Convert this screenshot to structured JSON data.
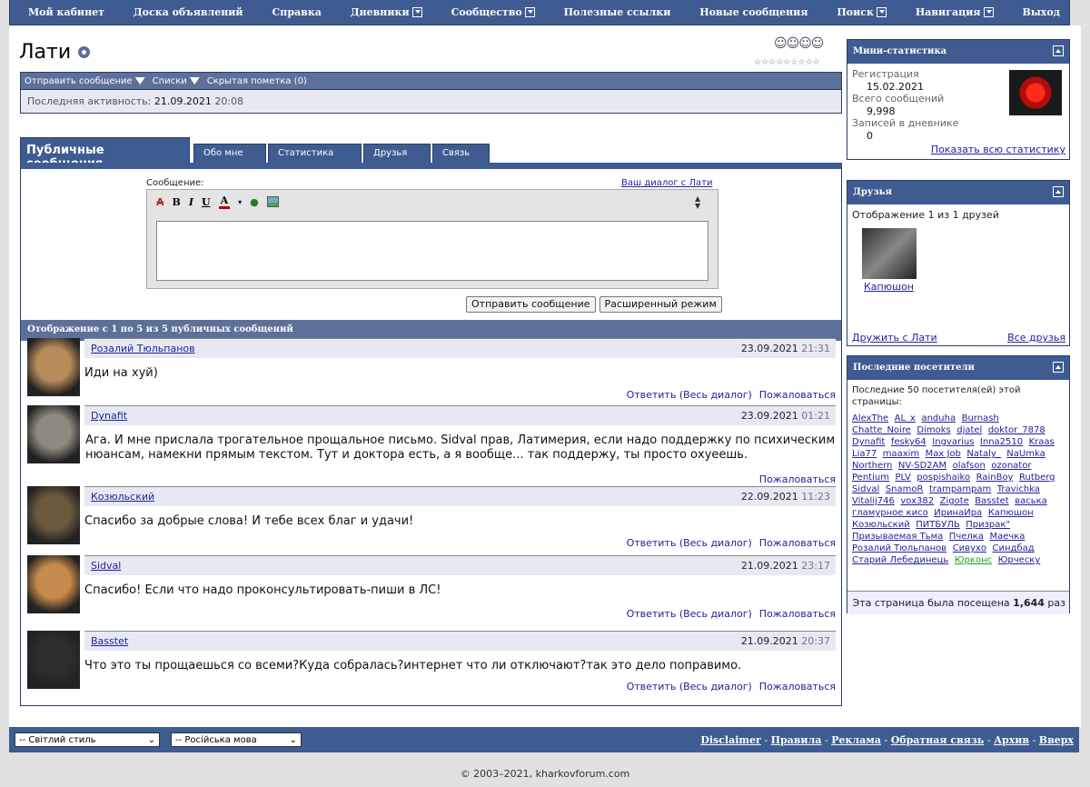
{
  "nav": [
    "Мой кабинет",
    "Доска объявлений",
    "Справка",
    "Дневники",
    "Сообщество",
    "Полезные ссылки",
    "Новые сообщения",
    "Поиск",
    "Навигация",
    "Выход"
  ],
  "nav_dropdown": [
    false,
    false,
    false,
    true,
    true,
    false,
    false,
    true,
    true,
    false
  ],
  "profile": {
    "name": "Лати",
    "smileys": "☺☺☺☺",
    "stars": "☆☆☆☆☆☆☆☆☆",
    "actions": [
      "Отправить сообщение",
      "Списки",
      "Скрытая пометка (0)"
    ],
    "activity_label": "Последняя активность:",
    "activity_date": "21.09.2021",
    "activity_time": "20:08"
  },
  "tabs": [
    "Публичные сообщения",
    "Обо мне",
    "Статистика",
    "Друзья",
    "Связь"
  ],
  "editor": {
    "label": "Сообщение:",
    "dialog_link": "Ваш диалог с Лати",
    "tools": [
      "B",
      "I",
      "U",
      "A"
    ],
    "send": "Отправить сообщение",
    "advanced": "Расширенный режим"
  },
  "list_header": "Отображение с 1 по 5 из 5 публичных сообщений",
  "messages": [
    {
      "user": "Розалий Тюльпанов",
      "date": "23.09.2021",
      "time": "21:31",
      "text": "Иди на хуй)",
      "reply": "Ответить (Весь диалог)",
      "report": "Пожаловаться",
      "color": "#b88c5a"
    },
    {
      "user": "Dynafit",
      "date": "23.09.2021",
      "time": "01:21",
      "text": "Ага. И мне прислала трогательное прощальное письмо. Sidval прав, Латимерия, если надо поддержку по психическим нюансам, намекни прямым текстом. Тут и доктора есть, а я вообще... так поддержу, ты просто охуеешь.",
      "reply": "",
      "report": "Пожаловаться",
      "color": "#8f8a80"
    },
    {
      "user": "Козюльский",
      "date": "22.09.2021",
      "time": "11:23",
      "text": "Спасибо за добрые слова! И тебе всех благ и удачи!",
      "reply": "Ответить (Весь диалог)",
      "report": "Пожаловаться",
      "color": "#6b5a3e"
    },
    {
      "user": "Sidval",
      "date": "21.09.2021",
      "time": "23:17",
      "text": "Спасибо! Если что надо проконсультировать-пиши в ЛС!",
      "reply": "Ответить (Весь диалог)",
      "report": "Пожаловаться",
      "color": "#c78a4c"
    },
    {
      "user": "Basstet",
      "date": "21.09.2021",
      "time": "20:37",
      "text": "Что это ты прощаешься со всеми?Куда собралась?интернет что ли отключают?так это дело поправимо.",
      "reply": "Ответить (Весь диалог)",
      "report": "Пожаловаться",
      "color": "#2d2d2d"
    }
  ],
  "ministats": {
    "title": "Мини-статистика",
    "reg_label": "Регистрация",
    "reg_value": "15.02.2021",
    "posts_label": "Всего сообщений",
    "posts_value": "9,998",
    "diary_label": "Записей в дневнике",
    "diary_value": "0",
    "show_all": "Показать всю статистику"
  },
  "friends": {
    "title": "Друзья",
    "showing": "Отображение 1 из 1 друзей",
    "friend": "Капюшон",
    "befriend": "Дружить с Лати",
    "all": "Все друзья"
  },
  "visitors": {
    "title": "Последние посетители",
    "intro": "Последние 50 посетителя(ей) этой страницы:",
    "names": [
      "AlexThe",
      "AL_x",
      "anduha",
      "Burnash",
      "Chatte_Noire",
      "Dimoks",
      "djatel",
      "doktor_7878",
      "Dynafit",
      "fesky64",
      "Ingvarius",
      "Inna2510",
      "Kraas",
      "Lia77",
      "maaxim",
      "Max Job",
      "Nataly_",
      "NaUmka",
      "Northern",
      "NV-SD2AM",
      "olafson",
      "ozonator",
      "Pentium",
      "PLV",
      "pospishaiko",
      "RainBoy",
      "Rutberg",
      "Sidval",
      "SnamoR",
      "trampampam",
      "Travichka",
      "Vitalij746",
      "vox382",
      "Zigote",
      "Basstet",
      "васька",
      "гламурное кисо",
      "ИринаИра",
      "Капюшон",
      "Козюльский",
      "ПИТБУЛЬ",
      "Призрак\"",
      "Призываемая Тьма",
      "Пчелка",
      "Маечка",
      "Розалий Тюльпанов",
      "Сивухо",
      "Синдбад",
      "Старий Лебединець",
      "Юрконс",
      "Юрческу"
    ],
    "green": "Юрконс",
    "views_label": "Эта страница была посещена",
    "views_count": "1,644",
    "views_suffix": "раз"
  },
  "footer": {
    "style": "-- Світлий стиль",
    "lang": "-- Російська мова",
    "links": [
      "Disclaimer",
      "Правила",
      "Реклама",
      "Обратная связь",
      "Архив",
      "Вверх"
    ],
    "copyright": "© 2003–2021, kharkovforum.com"
  }
}
